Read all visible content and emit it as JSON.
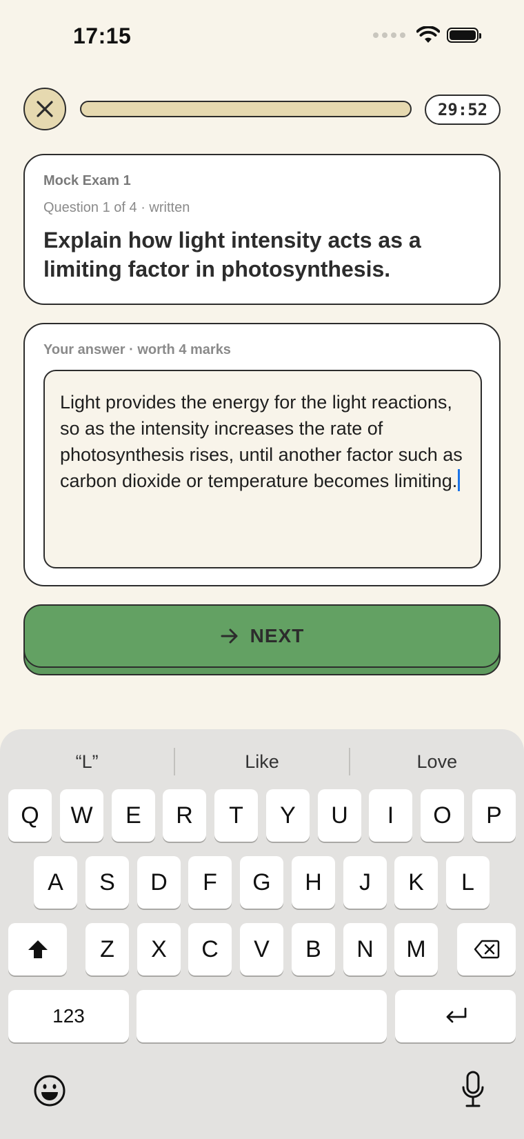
{
  "status_bar": {
    "time": "17:15"
  },
  "top_bar": {
    "progress": 0.0,
    "timer": "29:52"
  },
  "question_card": {
    "exam_name": "Mock Exam 1",
    "question_meta": "Question 1 of 4  ·  written",
    "question_text": "Explain how light intensity acts as a limiting factor in photosynthesis."
  },
  "answer_card": {
    "meta": "Your answer  ·  worth 4 marks",
    "answer_text": "Light provides the energy for the light reactions, so as the intensity increases the rate of photosynthesis rises, until another factor such as carbon dioxide or temperature becomes limiting."
  },
  "next_button": {
    "label": "NEXT"
  },
  "keyboard": {
    "suggestions": [
      "“L”",
      "Like",
      "Love"
    ],
    "row1": [
      "Q",
      "W",
      "E",
      "R",
      "T",
      "Y",
      "U",
      "I",
      "O",
      "P"
    ],
    "row2": [
      "A",
      "S",
      "D",
      "F",
      "G",
      "H",
      "J",
      "K",
      "L"
    ],
    "row3": [
      "Z",
      "X",
      "C",
      "V",
      "B",
      "N",
      "M"
    ],
    "numbers_key": "123",
    "icons": [
      "shift-icon",
      "backspace-icon",
      "return-icon",
      "emoji-icon",
      "microphone-icon"
    ]
  },
  "colors": {
    "background": "#f8f4ea",
    "accent_tan": "#e6d9b0",
    "next_green": "#63a163",
    "caret_blue": "#1a73e8"
  }
}
